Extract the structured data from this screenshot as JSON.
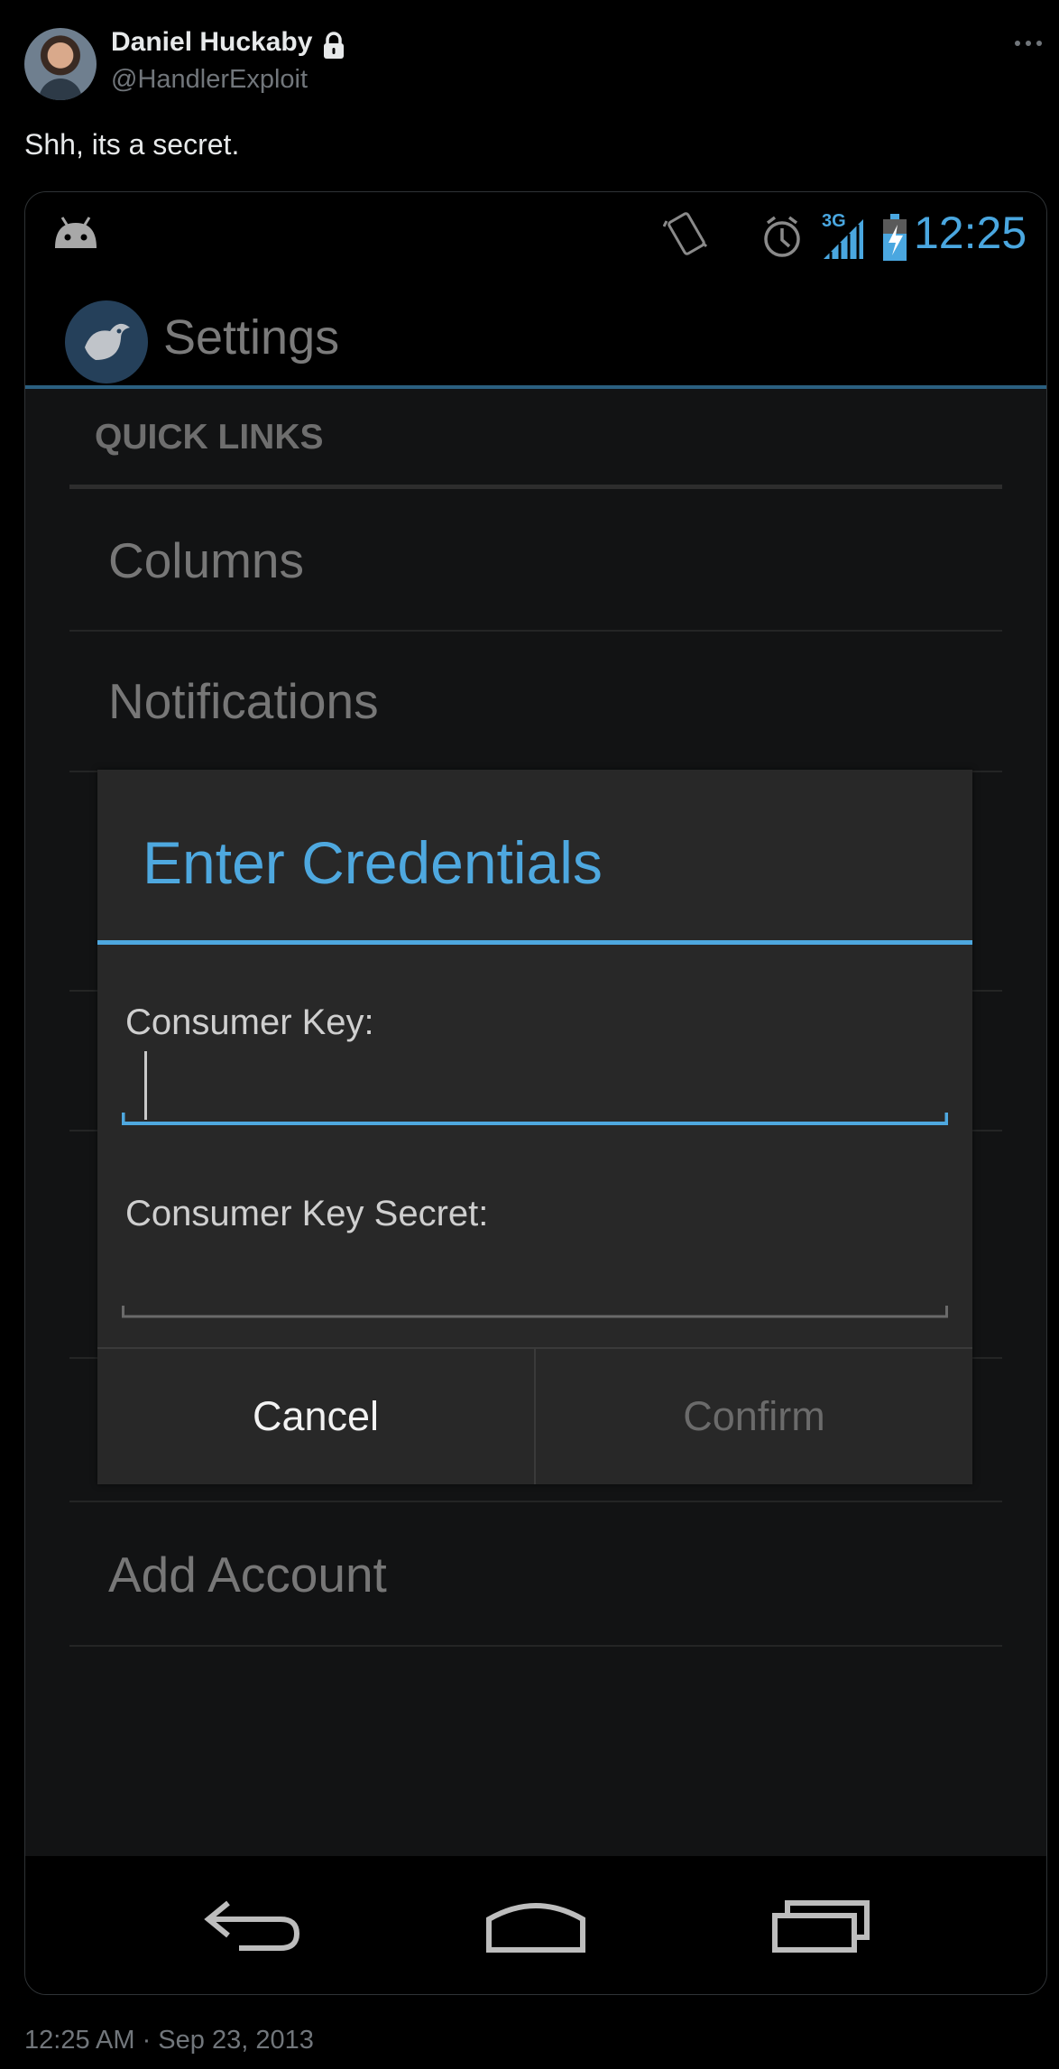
{
  "tweet": {
    "author_name": "Daniel Huckaby",
    "author_handle": "@HandlerExploit",
    "text": "Shh, its a secret.",
    "timestamp": "12:25 AM · Sep 23, 2013",
    "icons": [
      "lock-icon",
      "more-icon"
    ]
  },
  "phone": {
    "status_bar": {
      "time": "12:25",
      "network_label": "3G",
      "icons": [
        "android-icon",
        "vibrate-icon",
        "alarm-icon",
        "signal-icon",
        "battery-charging-icon"
      ],
      "accent_color": "#4aa7e0"
    },
    "action_bar": {
      "title": "Settings",
      "icon": "app-bird-logo"
    },
    "settings": {
      "section_header": "QUICK LINKS",
      "items": [
        {
          "label": "Columns"
        },
        {
          "label": "Notifications"
        },
        {
          "label": "Add Account"
        }
      ]
    },
    "dialog": {
      "title": "Enter Credentials",
      "accent_color": "#4ea8df",
      "fields": [
        {
          "label": "Consumer Key:",
          "value": "",
          "focused": true
        },
        {
          "label": "Consumer Key Secret:",
          "value": "",
          "focused": false
        }
      ],
      "cancel_label": "Cancel",
      "confirm_label": "Confirm",
      "confirm_enabled": false
    },
    "nav_bar": {
      "icons": [
        "back-icon",
        "home-icon",
        "recents-icon"
      ]
    }
  }
}
